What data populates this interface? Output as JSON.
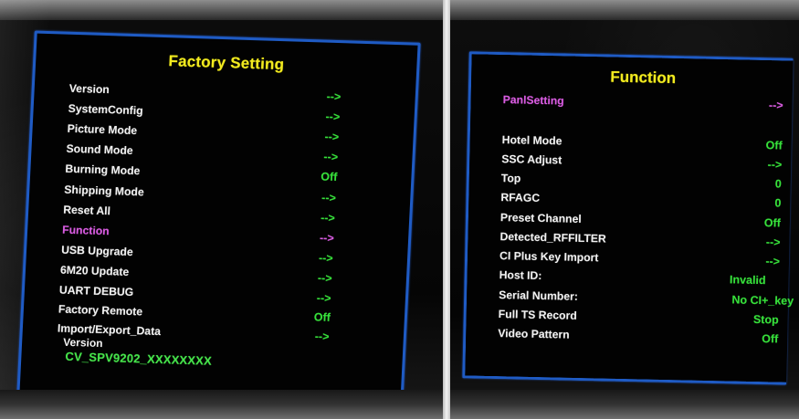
{
  "left_screen": {
    "title": "Factory Setting",
    "items": [
      {
        "label": "Version",
        "value": "-->"
      },
      {
        "label": "SystemConfig",
        "value": "-->"
      },
      {
        "label": "Picture Mode",
        "value": "-->"
      },
      {
        "label": "Sound Mode",
        "value": "-->"
      },
      {
        "label": "Burning Mode",
        "value": "Off"
      },
      {
        "label": "Shipping Mode",
        "value": "-->"
      },
      {
        "label": "Reset All",
        "value": "-->"
      },
      {
        "label": "Function",
        "value": "-->",
        "selected": true
      },
      {
        "label": "USB Upgrade",
        "value": "-->"
      },
      {
        "label": "6M20 Update",
        "value": "-->"
      },
      {
        "label": "UART DEBUG",
        "value": "-->"
      },
      {
        "label": "Factory Remote",
        "value": "Off"
      },
      {
        "label": "Import/Export_Data",
        "value": "-->"
      }
    ],
    "version_label": "Version",
    "version_value": "CV_SPV9202_XXXXXXXX"
  },
  "right_screen": {
    "title": "Function",
    "items": [
      {
        "label": "PanlSetting",
        "value": "-->",
        "selected": true
      },
      {
        "label": "Hotel Mode",
        "value": "Off"
      },
      {
        "label": "SSC Adjust",
        "value": "-->"
      },
      {
        "label": "Top",
        "value": "0"
      },
      {
        "label": "RFAGC",
        "value": "0"
      },
      {
        "label": "Preset Channel",
        "value": "Off"
      },
      {
        "label": "Detected_RFFILTER",
        "value": "-->"
      },
      {
        "label": "CI Plus Key Import",
        "value": "-->"
      },
      {
        "label": "Host ID:",
        "value": "Invalid"
      },
      {
        "label": "Serial Number:",
        "value": "No CI+_key"
      },
      {
        "label": "Full TS Record",
        "value": "Stop"
      },
      {
        "label": "Video Pattern",
        "value": "Off"
      }
    ]
  },
  "colors": {
    "border_blue": "#1f5bc4",
    "title_yellow": "#f2ea20",
    "value_green": "#37e03b",
    "selected_magenta": "#d85ce0",
    "label_white": "#f1f1f1",
    "background": "#020202"
  }
}
